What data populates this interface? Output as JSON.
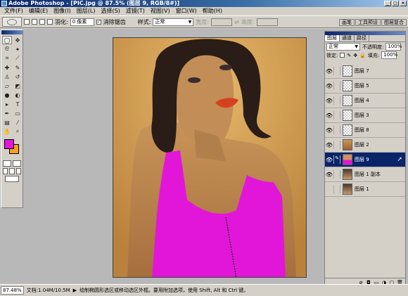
{
  "window": {
    "title": "Adobe Photoshop - [PIC.jpg @ 87.5% (图层 9, RGB/8#)]"
  },
  "menu": [
    "文件(F)",
    "编辑(E)",
    "图像(I)",
    "图层(L)",
    "选择(S)",
    "滤镜(T)",
    "视图(V)",
    "窗口(W)",
    "帮助(H)"
  ],
  "options": {
    "feather_label": "羽化:",
    "feather_value": "0 像素",
    "antialias_label": "消除锯齿",
    "style_label": "样式:",
    "style_value": "正常",
    "width_label": "宽度:",
    "height_label": "高度:",
    "panel_tabs": [
      "画笔",
      "工具预设",
      "图层复合"
    ]
  },
  "colors": {
    "foreground": "#e216d8",
    "background": "#f5a020",
    "selection": "#0a246a"
  },
  "layers_panel": {
    "tabs": [
      "图层",
      "通道",
      "路径"
    ],
    "blend_mode": "正常",
    "opacity_label": "不透明度:",
    "opacity_value": "100%",
    "lock_label": "锁定:",
    "fill_label": "填充:",
    "fill_value": "100%",
    "items": [
      {
        "name": "图层 7",
        "visible": true,
        "thumb": "transparent"
      },
      {
        "name": "图层 5",
        "visible": true,
        "thumb": "transparent"
      },
      {
        "name": "图层 4",
        "visible": true,
        "thumb": "transparent"
      },
      {
        "name": "图层 3",
        "visible": true,
        "thumb": "transparent"
      },
      {
        "name": "图层 8",
        "visible": true,
        "thumb": "transparent"
      },
      {
        "name": "图层 2",
        "visible": true,
        "thumb": "skin"
      },
      {
        "name": "图层 9",
        "visible": true,
        "thumb": "magenta",
        "active": true
      },
      {
        "name": "图层 1 副本",
        "visible": true,
        "thumb": "photo"
      },
      {
        "name": "图层 1",
        "visible": false,
        "thumb": "photo"
      }
    ]
  },
  "status": {
    "zoom": "87.48%",
    "doc": "文档:1.04M/10.5M",
    "hint": "绘制椭圆形选区或移动选区外框。要用附加选项，使用 Shift, Alt 和 Ctrl 键。"
  }
}
